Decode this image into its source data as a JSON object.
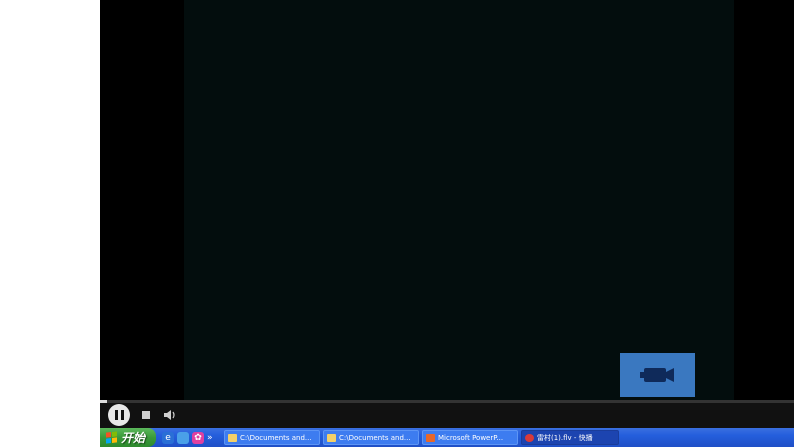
{
  "player": {
    "progress_fraction": 0.01,
    "controls": {
      "pause_icon": "pause-icon",
      "stop_icon": "stop-icon",
      "volume_icon": "volume-icon"
    },
    "overlay_icon": "video-camera-icon",
    "colors": {
      "badge": "#3a78c0",
      "video_bg": "#030d0d"
    }
  },
  "taskbar": {
    "start_label": "开始",
    "quick_launch_more": "»",
    "tasks": [
      {
        "label": "C:\\Documents and...",
        "icon": "folder-icon"
      },
      {
        "label": "C:\\Documents and...",
        "icon": "folder-icon"
      },
      {
        "label": "Microsoft PowerP...",
        "icon": "powerpoint-icon"
      },
      {
        "label": "雷村(1).flv - 快播",
        "icon": "qvod-player-icon"
      }
    ]
  }
}
